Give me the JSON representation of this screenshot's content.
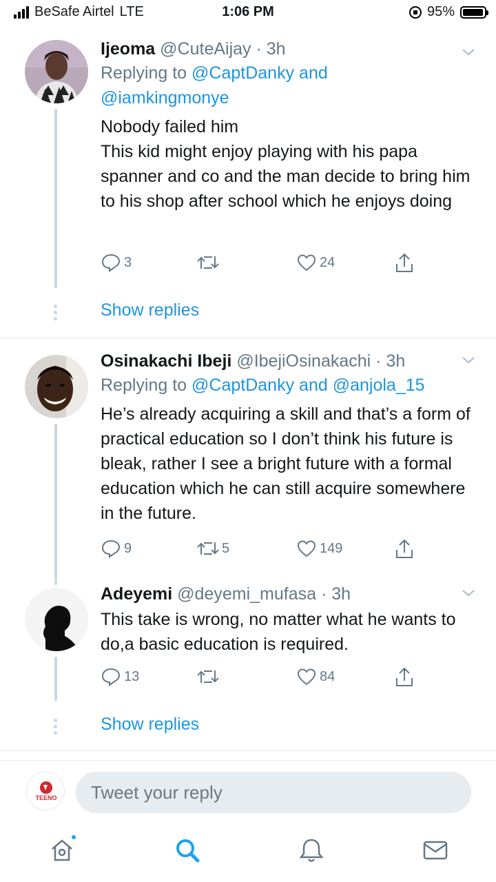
{
  "status_bar": {
    "carrier": "BeSafe Airtel",
    "network": "LTE",
    "time": "1:06 PM",
    "battery": "95%",
    "battery_level": 0.95
  },
  "tweets": [
    {
      "name": "Ijeoma",
      "handle": "@CuteAijay",
      "time": "3h",
      "replying_prefix": "Replying to",
      "replying_to_1": "@CaptDanky",
      "replying_and": "and",
      "replying_to_2": "@iamkingmonye",
      "text_lines": [
        "Nobody failed him",
        "This kid might enjoy playing with his papa spanner and co and the man decide to bring him to his shop after school which he enjoys doing"
      ],
      "replies": "3",
      "retweets": "",
      "likes": "24",
      "show_replies": "Show replies"
    },
    {
      "name": "Osinakachi Ibeji",
      "handle": "@IbejiOsinakachi",
      "time": "3h",
      "replying_prefix": "Replying to",
      "replying_to_1": "@CaptDanky",
      "replying_and": "and",
      "replying_to_2": "@anjola_15",
      "text": "He’s already acquiring a skill and that’s a form of practical education so I don’t think his future is bleak, rather I see a bright future with a formal education which he can still acquire somewhere in the future.",
      "replies": "9",
      "retweets": "5",
      "likes": "149"
    },
    {
      "name": "Adeyemi",
      "handle": "@deyemi_mufasa",
      "time": "3h",
      "text": "This take is wrong, no matter what he wants to do,a basic education is required.",
      "replies": "13",
      "retweets": "",
      "likes": "84",
      "show_replies": "Show replies"
    }
  ],
  "reply_bar": {
    "placeholder": "Tweet your reply",
    "avatar_text": "TEENO"
  },
  "tab_bar": {
    "items": [
      "home-icon",
      "search-icon",
      "notifications-icon",
      "messages-icon"
    ]
  },
  "colors": {
    "link": "#1b95e0",
    "secondary": "#657786",
    "divider": "#e1e8ed",
    "thread": "#ccd6dd"
  }
}
